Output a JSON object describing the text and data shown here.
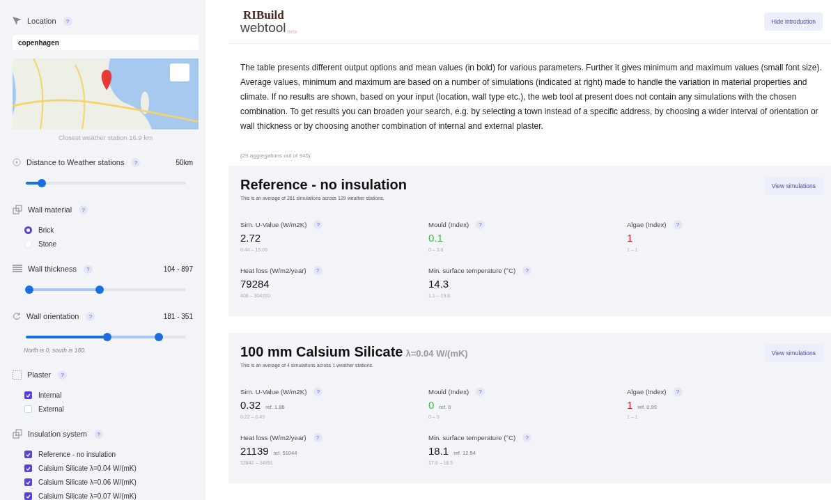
{
  "sidebar": {
    "location": {
      "label": "Location",
      "help": "?",
      "value": "copenhagen",
      "caption": "Closest weather station 16.9 km"
    },
    "filters": [
      {
        "kind": "slider",
        "label": "Distance to Weather stations",
        "help": "?",
        "reading": "50km",
        "thumbs": [
          {
            "level": 0.1
          }
        ]
      },
      {
        "kind": "radio",
        "label": "Wall material",
        "help": "?",
        "options": [
          {
            "label": "Brick",
            "selected": true
          },
          {
            "label": "Stone",
            "selected": false
          }
        ]
      },
      {
        "kind": "slider",
        "label": "Wall thickness",
        "help": "?",
        "reading": "104 - 897",
        "thumbs": [
          {
            "level": 0.02
          },
          {
            "level": 0.46
          }
        ]
      },
      {
        "kind": "slider",
        "label": "Wall orientation",
        "help": "?",
        "reading": "181 - 351",
        "thumbs": [
          {
            "level": 0.51
          },
          {
            "level": 0.83
          }
        ],
        "note": "North is 0, south is 180."
      },
      {
        "kind": "checkbox",
        "label": "Plaster",
        "help": "?",
        "options": [
          {
            "label": "Internal",
            "checked": true
          },
          {
            "label": "External",
            "checked": false
          }
        ]
      },
      {
        "kind": "checkbox",
        "label": "Insulation system",
        "help": "?",
        "options": [
          {
            "label": "Reference - no insulation",
            "checked": true
          },
          {
            "label": "Calsium Silicate λ=0.04 W/(mK)",
            "checked": true
          },
          {
            "label": "Calsium Silicate λ=0.06 W/(mK)",
            "checked": true
          },
          {
            "label": "Calsium Silicate λ=0.07 W/(mK)",
            "checked": true
          }
        ]
      }
    ]
  },
  "header": {
    "logo": {
      "name": "RIBuild",
      "product": "webtool",
      "tag": "beta"
    },
    "button": "Hide introduction"
  },
  "intro": "The table presents different output options and mean values (in bold) for various parameters. Further it gives minimum and maximum values (small font size). Average values, minimum and maximum are based on a number of simulations (indicated at right) made to handle the variation in material properties and climate. If no results are shown, based on your input (location, wall type etc.), the web tool at present does not contain any simulations with the chosen combination. To get results you can broaden your search, e.g. by selecting a town instead of a specific address, by choosing a wider interval of orientation or wall thickness or by choosing another combination of internal and external plaster.",
  "count": "(29 aggregations out of 945)",
  "results": [
    {
      "title": "Reference - no insulation",
      "subtitle": "This is an average of 261 simulations across 129 weather stations.",
      "button": "View simulations",
      "metrics": [
        {
          "label": "Sim. U-Value (W/m2K)",
          "help": "?",
          "value": "2.72",
          "range": "0.44 – 15.09",
          "color": "#111111"
        },
        {
          "label": "Mould (Index)",
          "help": "?",
          "value": "0.1",
          "range": "0 – 3.6",
          "color": "#3cc23c"
        },
        {
          "label": "Algae (Index)",
          "help": "?",
          "value": "1",
          "range": "1 – 1",
          "color": "#d0142c"
        },
        {
          "label": "Heat loss (W/m2/year)",
          "help": "?",
          "value": "79284",
          "range": "408 – 304220",
          "color": "#111111"
        },
        {
          "label": "Min. surface temperature (°C)",
          "help": "?",
          "value": "14.3",
          "range": "1.1 – 19.8",
          "color": "#111111"
        }
      ]
    },
    {
      "title": "100 mm Calsium Silicate",
      "title_note": "λ=0.04 W/(mK)",
      "subtitle": "This is an average of 4 simulations across 1 weather stations.",
      "button": "View simulations",
      "metrics": [
        {
          "label": "Sim. U-Value (W/m2K)",
          "help": "?",
          "value": "0.32",
          "ref": "ref. 1.86",
          "range": "0.22 – 0.49",
          "color": "#111111"
        },
        {
          "label": "Mould (Index)",
          "help": "?",
          "value": "0",
          "ref": "ref. 0",
          "range": "0 – 0",
          "color": "#3cc23c"
        },
        {
          "label": "Algae (Index)",
          "help": "?",
          "value": "1",
          "ref": "ref. 0.99",
          "range": "1 – 1",
          "color": "#d0142c"
        },
        {
          "label": "Heat loss (W/m2/year)",
          "help": "?",
          "value": "21139",
          "ref": "ref. 51044",
          "range": "12842 – 34951",
          "color": "#111111"
        },
        {
          "label": "Min. surface temperature (°C)",
          "help": "?",
          "value": "18.1",
          "ref": "ref. 12.54",
          "range": "17.6 – 18.5",
          "color": "#111111"
        }
      ]
    }
  ]
}
